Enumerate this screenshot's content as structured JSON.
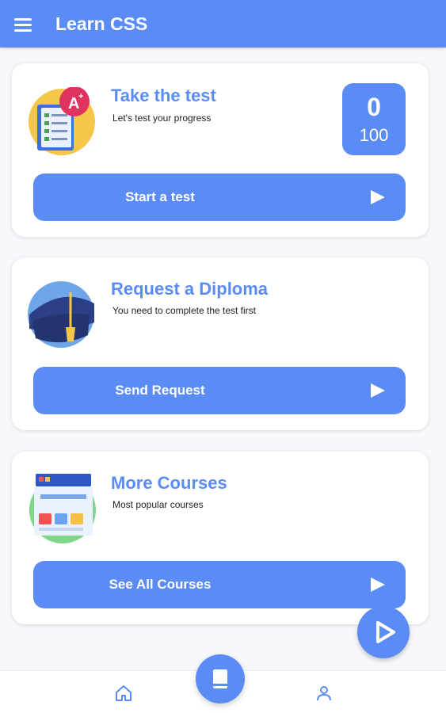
{
  "app": {
    "title": "Learn CSS",
    "accent_color": "#5b8cf6"
  },
  "cards": [
    {
      "title": "Take the test",
      "subtitle": "Let's test your progress",
      "button_label": "Start a test",
      "score": {
        "value": "0",
        "max": "100"
      }
    },
    {
      "title": "Request a Diploma",
      "subtitle": "You need to complete the test first",
      "button_label": "Send Request"
    },
    {
      "title": "More Courses",
      "subtitle": "Most popular courses",
      "button_label": "See All Courses"
    }
  ],
  "bottom_nav": {
    "items": [
      "home-icon",
      "book-icon",
      "profile-icon"
    ]
  },
  "icons": {
    "menu": "menu-icon",
    "play": "play-icon",
    "arrow": "arrow-right-icon"
  }
}
